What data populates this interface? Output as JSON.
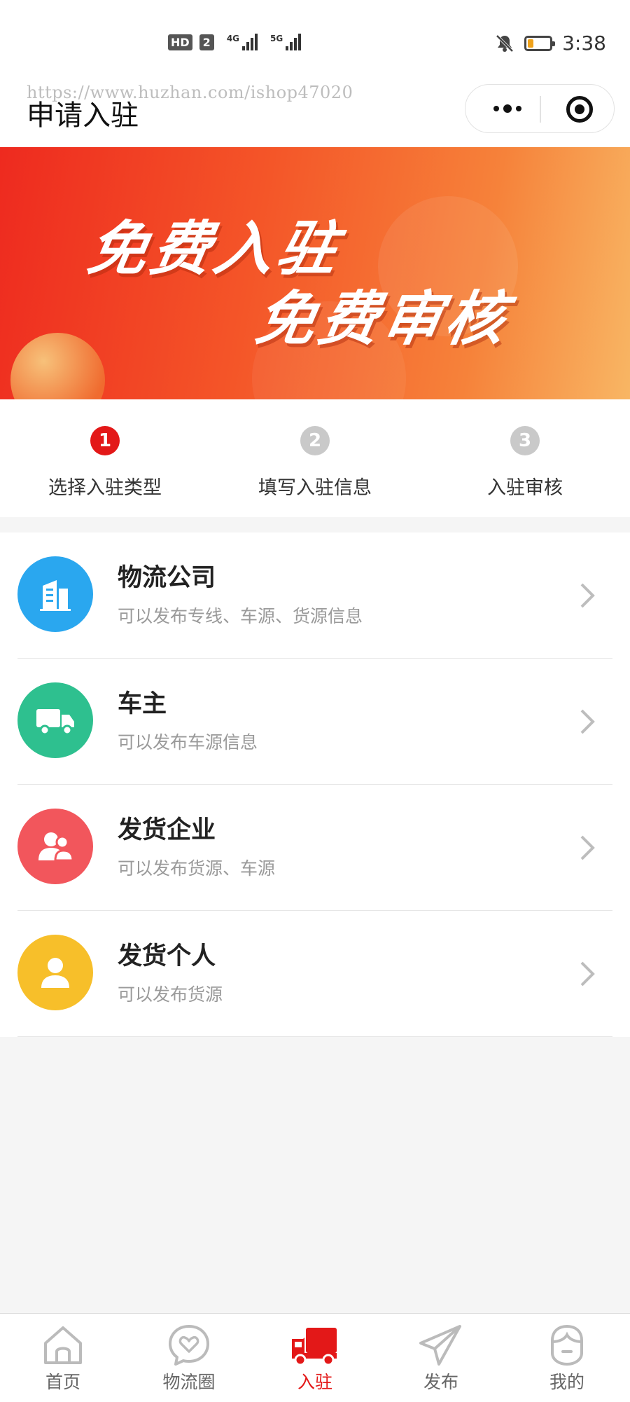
{
  "status_bar": {
    "hd": "HD",
    "sim": "2",
    "net1": "4G",
    "net2": "5G",
    "time": "3:38"
  },
  "nav": {
    "watermark": "https://www.huzhan.com/ishop47020",
    "title": "申请入驻"
  },
  "banner": {
    "line1": "免费入驻",
    "line2": "免费审核"
  },
  "steps": [
    {
      "num": "1",
      "label": "选择入驻类型",
      "active": true
    },
    {
      "num": "2",
      "label": "填写入驻信息",
      "active": false
    },
    {
      "num": "3",
      "label": "入驻审核",
      "active": false
    }
  ],
  "types": [
    {
      "title": "物流公司",
      "desc": "可以发布专线、车源、货源信息",
      "icon": "building-icon",
      "color": "#2aa7ef"
    },
    {
      "title": "车主",
      "desc": "可以发布车源信息",
      "icon": "truck-icon",
      "color": "#2ec08f"
    },
    {
      "title": "发货企业",
      "desc": "可以发布货源、车源",
      "icon": "users-icon",
      "color": "#f2565c"
    },
    {
      "title": "发货个人",
      "desc": "可以发布货源",
      "icon": "user-icon",
      "color": "#f7bf2a"
    }
  ],
  "tabbar": [
    {
      "label": "首页",
      "icon": "home-icon",
      "active": false
    },
    {
      "label": "物流圈",
      "icon": "heart-chat-icon",
      "active": false
    },
    {
      "label": "入驻",
      "icon": "truck-icon",
      "active": true
    },
    {
      "label": "发布",
      "icon": "send-icon",
      "active": false
    },
    {
      "label": "我的",
      "icon": "profile-icon",
      "active": false
    }
  ],
  "colors": {
    "accent": "#e31818",
    "inactive_step": "#c9c9c9",
    "tab_inactive": "#666666"
  }
}
